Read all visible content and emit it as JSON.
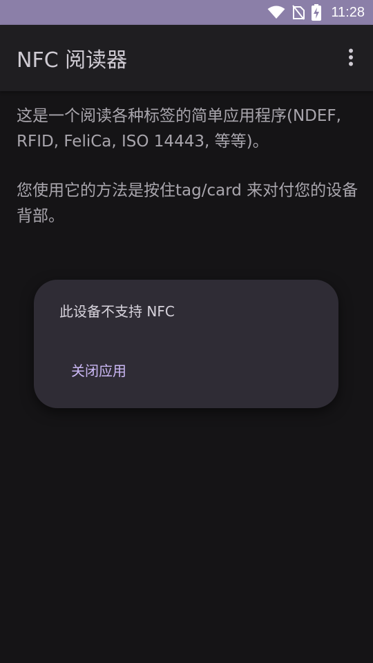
{
  "status_bar": {
    "time": "11:28",
    "icons": [
      "wifi-icon",
      "no-sim-icon",
      "battery-charging-icon"
    ],
    "background": "#8b7fa8"
  },
  "app_bar": {
    "title": "NFC 阅读器",
    "menu_icon": "more-vert-icon"
  },
  "content": {
    "paragraph1": "这是一个阅读各种标签的简单应用程序(NDEF, RFID, FeliCa, ISO 14443, 等等)。",
    "paragraph2": "您使用它的方法是按住tag/card 来对付您的设备背部。"
  },
  "dialog": {
    "message": "此设备不支持 NFC",
    "button_label": "关闭应用",
    "accent": "#cbb8f5"
  }
}
